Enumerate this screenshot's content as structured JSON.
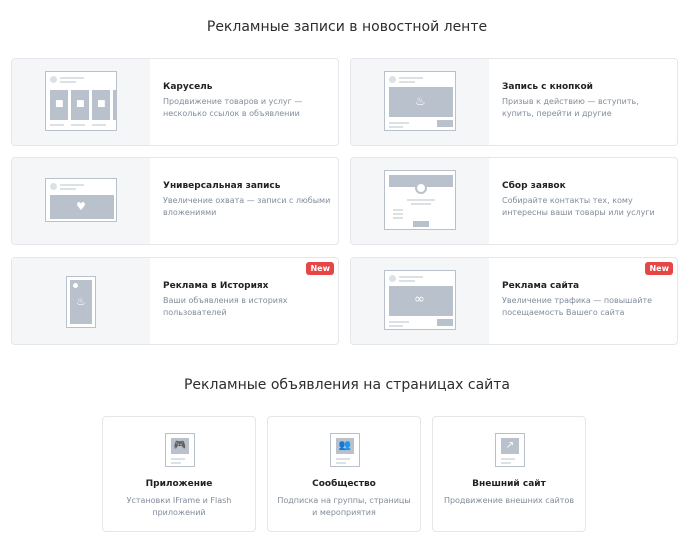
{
  "sections": {
    "feed_title": "Рекламные записи в новостной ленте",
    "site_title": "Рекламные объявления на страницах сайта"
  },
  "feed_cards": [
    {
      "title": "Карусель",
      "desc": "Продвижение товаров и услуг — несколько ссылок в объявлении",
      "icon": "carousel-icon"
    },
    {
      "title": "Запись с кнопкой",
      "desc": "Призыв к действию — вступить, купить, перейти и другие",
      "icon": "button-post-icon"
    },
    {
      "title": "Универсальная запись",
      "desc": "Увеличение охвата — записи с любыми вложениями",
      "icon": "universal-post-icon"
    },
    {
      "title": "Сбор заявок",
      "desc": "Собирайте контакты тех, кому интересны ваши товары или услуги",
      "icon": "lead-form-icon"
    },
    {
      "title": "Реклама в Историях",
      "desc": "Ваши объявления в историях пользователей",
      "badge": "New",
      "icon": "stories-icon"
    },
    {
      "title": "Реклама сайта",
      "desc": "Увеличение трафика — повышайте посещаемость Вашего сайта",
      "badge": "New",
      "icon": "website-icon"
    }
  ],
  "site_cards": [
    {
      "title": "Приложение",
      "desc": "Установки IFrame и Flash приложений",
      "icon": "gamepad-icon"
    },
    {
      "title": "Сообщество",
      "desc": "Подписка на группы, страницы и мероприятия",
      "icon": "community-icon"
    },
    {
      "title": "Внешний сайт",
      "desc": "Продвижение внешних сайтов",
      "icon": "external-link-icon"
    }
  ]
}
